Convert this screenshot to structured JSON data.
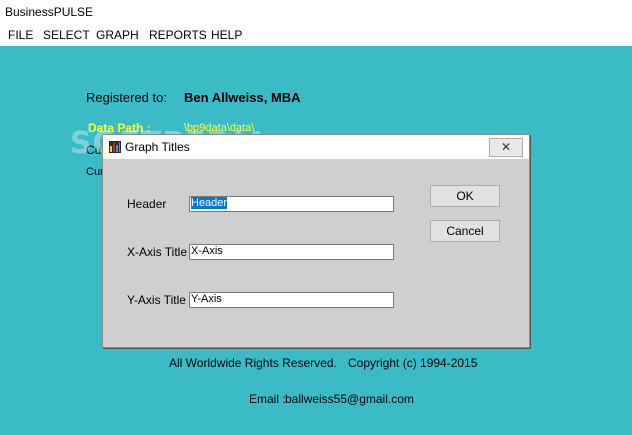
{
  "window": {
    "title": "BusinessPULSE"
  },
  "menu": {
    "items": [
      "FILE",
      "SELECT",
      "GRAPH",
      "REPORTS",
      "HELP"
    ]
  },
  "background": {
    "registered_label": "Registered to:",
    "registered_name": "Ben Allweiss, MBA",
    "data_path_label": "Data Path :",
    "data_path_value": "\\bp9data\\data\\",
    "partial_line_1": "Cu",
    "partial_line_2": "Cur",
    "rights": "All Worldwide Rights Reserved.",
    "copyright": "Copyright (c) 1994-2015",
    "email_label": "Email :",
    "email_value": "ballweiss55@gmail.com",
    "watermark": "SOFTPEDIA"
  },
  "dialog": {
    "title": "Graph Titles",
    "close_glyph": "✕",
    "fields": [
      {
        "label": "Header",
        "value": "Header"
      },
      {
        "label": "X-Axis Title",
        "value": "X-Axis"
      },
      {
        "label": "Y-Axis Title",
        "value": "Y-Axis"
      }
    ],
    "ok_label": "OK",
    "cancel_label": "Cancel"
  },
  "colors": {
    "client_bg": "#3bbbc6",
    "data_path": "#ffff33",
    "dialog_bg": "#cfcfcf",
    "selection": "#0078d7"
  },
  "icons": {
    "dialog_icon": "app-graph-icon"
  }
}
